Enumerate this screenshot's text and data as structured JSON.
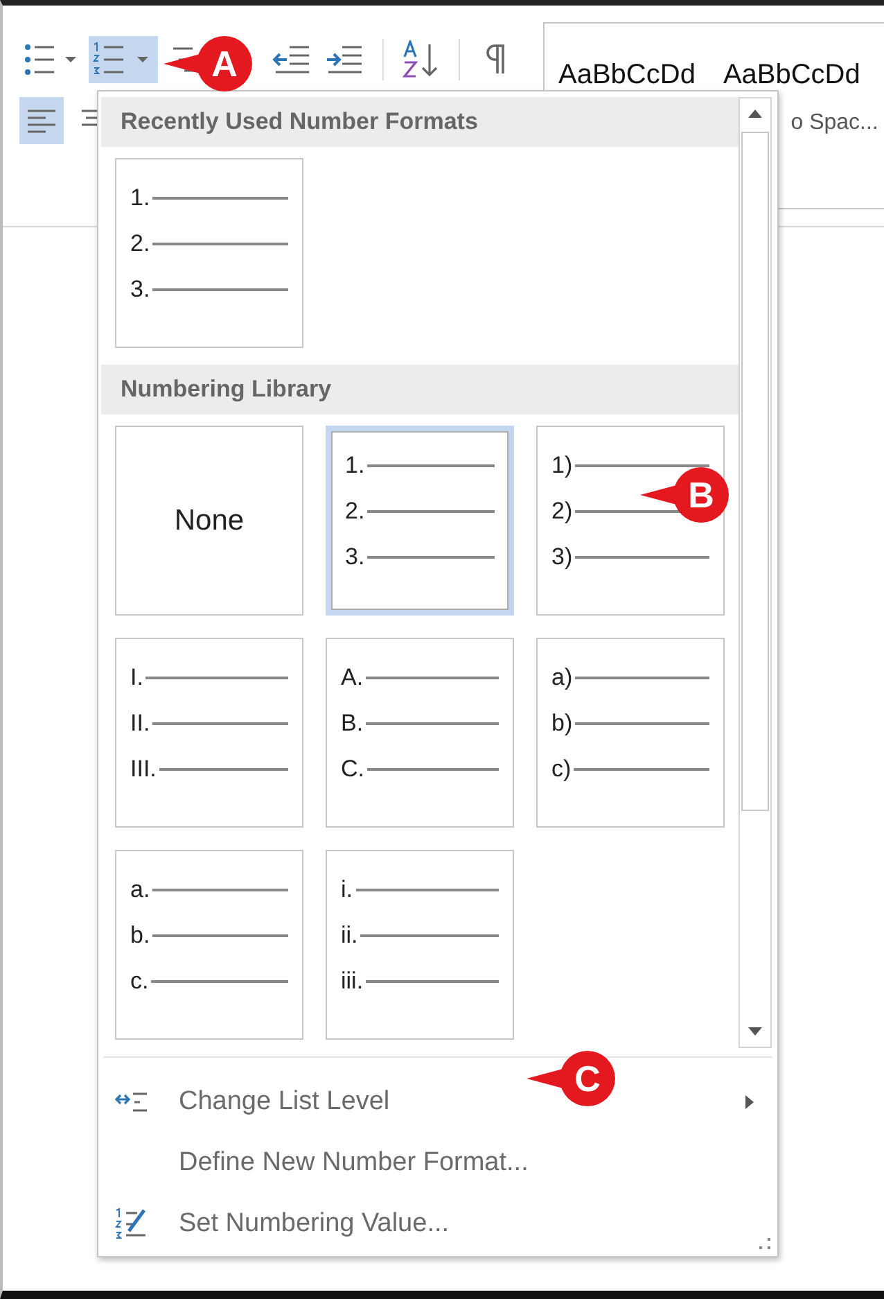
{
  "ribbon": {
    "tools": [
      {
        "kind": "bullets",
        "selected": false
      },
      {
        "kind": "numbering",
        "selected": true
      },
      {
        "kind": "multilevel",
        "selected": false
      },
      {
        "kind": "outdent",
        "selected": false
      },
      {
        "kind": "indent",
        "selected": false
      },
      {
        "kind": "sort",
        "selected": false
      },
      {
        "kind": "pilcrow",
        "selected": false
      }
    ],
    "align_tools": [
      {
        "kind": "left",
        "selected": true
      },
      {
        "kind": "center",
        "selected": false
      }
    ],
    "styles": [
      {
        "sample": "AaBbCcDd"
      },
      {
        "sample": "AaBbCcDd",
        "name": "o Spac..."
      }
    ]
  },
  "menu": {
    "sections": [
      {
        "title": "Recently Used Number Formats",
        "tiles": [
          {
            "kind": "list",
            "selected": false,
            "markers": [
              "1.",
              "2.",
              "3."
            ]
          }
        ]
      },
      {
        "title": "Numbering Library",
        "tiles": [
          {
            "kind": "none",
            "selected": false,
            "label": "None"
          },
          {
            "kind": "list",
            "selected": true,
            "markers": [
              "1.",
              "2.",
              "3."
            ]
          },
          {
            "kind": "list",
            "selected": false,
            "markers": [
              "1)",
              "2)",
              "3)"
            ]
          },
          {
            "kind": "list",
            "selected": false,
            "markers": [
              "I.",
              "II.",
              "III."
            ]
          },
          {
            "kind": "list",
            "selected": false,
            "markers": [
              "A.",
              "B.",
              "C."
            ]
          },
          {
            "kind": "list",
            "selected": false,
            "markers": [
              "a)",
              "b)",
              "c)"
            ]
          },
          {
            "kind": "list",
            "selected": false,
            "markers": [
              "a.",
              "b.",
              "c."
            ]
          },
          {
            "kind": "list",
            "selected": false,
            "markers": [
              "i.",
              "ii.",
              "iii."
            ]
          }
        ]
      }
    ],
    "commands": [
      {
        "label": "Change List Level",
        "kind": "level",
        "submenu": true
      },
      {
        "label": "Define New Number Format...",
        "kind": "plain",
        "submenu": false
      },
      {
        "label": "Set Numbering Value...",
        "kind": "value",
        "submenu": false
      }
    ]
  },
  "callouts": [
    {
      "label": "A",
      "kind": "left"
    },
    {
      "label": "B",
      "kind": "left"
    },
    {
      "label": "C",
      "kind": "left"
    }
  ]
}
